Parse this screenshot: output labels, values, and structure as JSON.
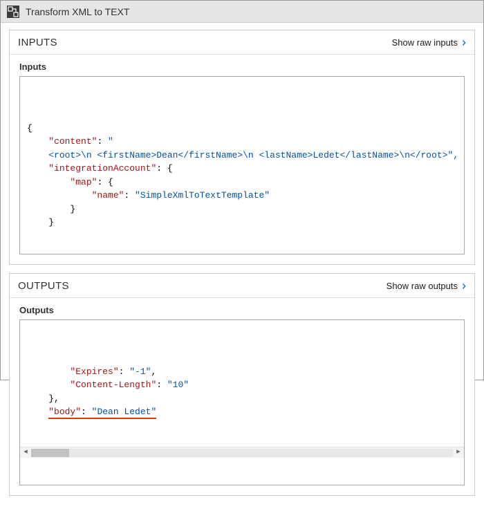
{
  "header": {
    "title": "Transform XML to TEXT"
  },
  "inputs": {
    "panel_title": "INPUTS",
    "show_raw": "Show raw inputs",
    "sub_label": "Inputs",
    "code": {
      "l1": "{",
      "l2_k": "\"content\"",
      "l2_v": "\"",
      "l3": "<root>\\n <firstName>Dean</firstName>\\n <lastName>Ledet</lastName>\\n</root>\",",
      "l4_k": "\"integrationAccount\"",
      "l4_v": ": {",
      "l5_k": "\"map\"",
      "l5_v": ": {",
      "l6_k": "\"name\"",
      "l6_v": "\"SimpleXmlToTextTemplate\"",
      "l7": "        }",
      "l8": "    }",
      "l9": "}"
    }
  },
  "outputs": {
    "panel_title": "OUTPUTS",
    "show_raw": "Show raw outputs",
    "sub_label": "Outputs",
    "code": {
      "l1_k": "\"Expires\"",
      "l1_v": "\"-1\"",
      "l2_k": "\"Content-Length\"",
      "l2_v": "\"10\"",
      "l3": "    },",
      "l4_k": "\"body\"",
      "l4_v": "\"Dean Ledet\"",
      "l5": "}"
    }
  }
}
